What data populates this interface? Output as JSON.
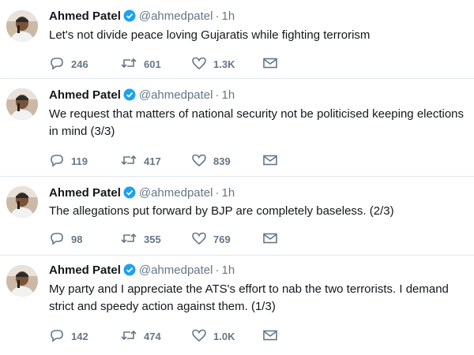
{
  "tweets": [
    {
      "name": "Ahmed Patel",
      "handle": "@ahmedpatel",
      "time": "1h",
      "text": "Let's not divide peace loving Gujaratis while fighting terrorism",
      "replies": "246",
      "retweets": "601",
      "likes": "1.3K"
    },
    {
      "name": "Ahmed Patel",
      "handle": "@ahmedpatel",
      "time": "1h",
      "text": "We request that matters of national security not be politicised keeping elections in mind (3/3)",
      "replies": "119",
      "retweets": "417",
      "likes": "839"
    },
    {
      "name": "Ahmed Patel",
      "handle": "@ahmedpatel",
      "time": "1h",
      "text": "The allegations put forward by BJP are completely baseless. (2/3)",
      "replies": "98",
      "retweets": "355",
      "likes": "769"
    },
    {
      "name": "Ahmed Patel",
      "handle": "@ahmedpatel",
      "time": "1h",
      "text": "My party and I appreciate the ATS's effort to nab the two terrorists. I demand strict and speedy action against them. (1/3)",
      "replies": "142",
      "retweets": "474",
      "likes": "1.0K"
    }
  ],
  "icons": {
    "verified": "verified-badge-icon",
    "reply": "reply-icon",
    "retweet": "retweet-icon",
    "like": "heart-icon",
    "message": "direct-message-icon"
  },
  "colors": {
    "verified": "#1da1f2",
    "muted": "#657786",
    "text": "#14171a",
    "divider": "#e1e8ed"
  }
}
